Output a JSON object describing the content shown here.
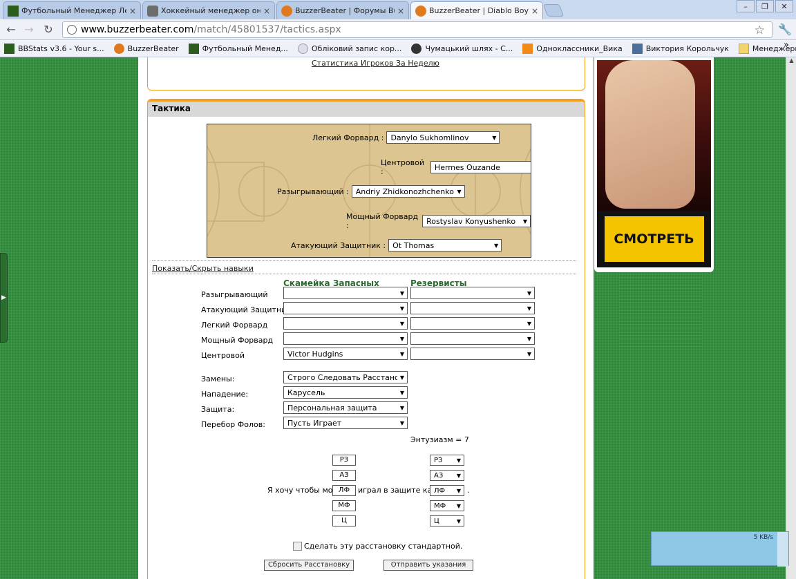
{
  "browser": {
    "tabs": [
      {
        "title": "Футбольный Менеджер Леги"
      },
      {
        "title": "Хоккейный менеджер онлай"
      },
      {
        "title": "BuzzerBeater | Форумы Buzze"
      },
      {
        "title": "BuzzerBeater | Diablo Boys @"
      }
    ],
    "url_host": "www.buzzerbeater.com",
    "url_path": "/match/45801537/tactics.aspx",
    "bookmarks": [
      {
        "label": "BBStats v3.6 - Your s..."
      },
      {
        "label": "BuzzerBeater"
      },
      {
        "label": "Футбольный Менед..."
      },
      {
        "label": "Обліковий запис кор..."
      },
      {
        "label": "Чумацький шлях - С..."
      },
      {
        "label": "Одноклассники_Вика"
      },
      {
        "label": "Виктория Корольчук"
      },
      {
        "label": "Менеджеры"
      }
    ]
  },
  "top_link": "Статистика Игроков За Неделю",
  "panel_title": "Тактика",
  "court": [
    {
      "label": "Легкий Форвард :",
      "player": "Danylo Sukhomlinov"
    },
    {
      "label": "Центровой :",
      "player": "Hermes Ouzande"
    },
    {
      "label": "Разыгрывающий :",
      "player": "Andriy Zhidkonozhchenko"
    },
    {
      "label": "Мощный Форвард :",
      "player": "Rostyslav Konyushenko"
    },
    {
      "label": "Атакующий Защитник :",
      "player": "Ot Thomas"
    }
  ],
  "toggle_skills": "Показать/Скрыть навыки",
  "bench_header": "Скамейка Запасных",
  "reserve_header": "Резервисты",
  "subs": [
    {
      "position": "Разыгрывающий",
      "bench": "",
      "reserve": ""
    },
    {
      "position": "Атакующий Защитник",
      "bench": "",
      "reserve": ""
    },
    {
      "position": "Легкий Форвард",
      "bench": "",
      "reserve": ""
    },
    {
      "position": "Мощный Форвард",
      "bench": "",
      "reserve": ""
    },
    {
      "position": "Центровой",
      "bench": "Victor Hudgins",
      "reserve": ""
    }
  ],
  "settings": [
    {
      "label": "Замены:",
      "value": "Строго Следовать Расстанови"
    },
    {
      "label": "Нападение:",
      "value": "Карусель"
    },
    {
      "label": "Защита:",
      "value": "Персональная защита"
    },
    {
      "label": "Перебор Фолов:",
      "value": "Пусть Играет"
    }
  ],
  "enthusiasm": "Энтузиазм = 7",
  "defense": {
    "before": "Я хочу чтобы мой",
    "after": "играл в защите как",
    "end": ".",
    "rows": [
      {
        "pos": "РЗ",
        "as": "РЗ"
      },
      {
        "pos": "АЗ",
        "as": "АЗ"
      },
      {
        "pos": "ЛФ",
        "as": "ЛФ"
      },
      {
        "pos": "МФ",
        "as": "МФ"
      },
      {
        "pos": "Ц",
        "as": "Ц"
      }
    ]
  },
  "default_label": "Сделать эту расстановку стандартной.",
  "reset_button": "Сбросить Расстановку",
  "submit_button": "Отправить указания",
  "ad_button": "СМОТРЕТЬ",
  "download_speed": "5 KB/s"
}
